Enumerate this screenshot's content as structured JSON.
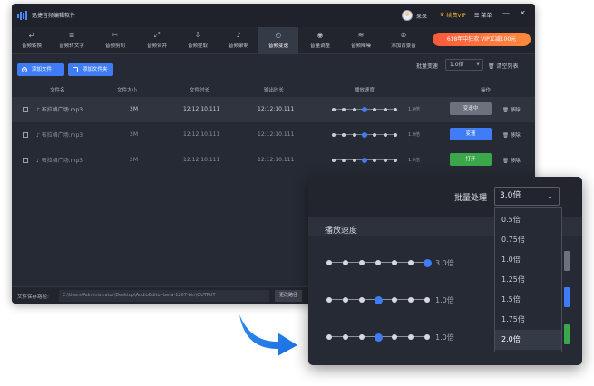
{
  "app": {
    "title": "迅捷音频编辑软件",
    "user": "呆呆",
    "vip": "续费VIP",
    "menu": "菜单",
    "win_min": "—",
    "win_close": "✕"
  },
  "toolbar": [
    {
      "label": "音频转换",
      "icon": "convert-icon",
      "glyph": "⇄"
    },
    {
      "label": "音频转文字",
      "icon": "text-icon",
      "glyph": "≣"
    },
    {
      "label": "音频剪切",
      "icon": "scissors-icon",
      "glyph": "✂"
    },
    {
      "label": "音频合并",
      "icon": "merge-icon",
      "glyph": "⤢"
    },
    {
      "label": "音频提取",
      "icon": "extract-icon",
      "glyph": "⇩"
    },
    {
      "label": "音频录制",
      "icon": "mic-icon",
      "glyph": "♪"
    },
    {
      "label": "音频变速",
      "icon": "speed-icon",
      "glyph": "◴",
      "active": true
    },
    {
      "label": "音量调整",
      "icon": "volume-icon",
      "glyph": "◉"
    },
    {
      "label": "音频降噪",
      "icon": "denoise-icon",
      "glyph": "≋"
    },
    {
      "label": "添加背景音",
      "icon": "music-icon",
      "glyph": "⊘"
    }
  ],
  "promo": "618年中狂欢 VIP立减100元",
  "actions": {
    "add_file": "添加文件",
    "add_folder": "添加文件夹",
    "batch_label": "批量变速",
    "batch_value": "1.0倍",
    "clear_list": "清空列表"
  },
  "columns": [
    "文件名",
    "文件大小",
    "文件时长",
    "输出时长",
    "播放速度",
    "操作"
  ],
  "rows": [
    {
      "name": "布拉格广场.mp3",
      "size": "2M",
      "duration": "12:12:10.111",
      "output": "12:12:10.111",
      "speed": "1.0倍",
      "action": "变速中",
      "remove": "移除",
      "active_dot": 3
    },
    {
      "name": "布拉格广场.mp3",
      "size": "2M",
      "duration": "12:12:10.111",
      "output": "12:12:10.111",
      "speed": "1.0倍",
      "action": "变速",
      "remove": "移除",
      "active_dot": 3
    },
    {
      "name": "布拉格广场.mp3",
      "size": "2M",
      "duration": "12:12:10.111",
      "output": "12:12:10.111",
      "speed": "1.0倍",
      "action": "打开",
      "remove": "移除",
      "active_dot": 3
    }
  ],
  "footer": {
    "label": "文件保存路径:",
    "path": "C:\\Users\\Administrator\\Desktop\\AudioEditor-beta-1207-bin\\OUTPUT",
    "change": "更改路径"
  },
  "zoom": {
    "batch_label": "批量处理",
    "batch_value": "3.0倍",
    "speed_header": "播放速度",
    "sliders": [
      {
        "value": "3.0倍",
        "active_dot": 6
      },
      {
        "value": "1.0倍",
        "active_dot": 3
      },
      {
        "value": "1.0倍",
        "active_dot": 3
      }
    ],
    "options": [
      "0.5倍",
      "0.75倍",
      "1.0倍",
      "1.25倍",
      "1.5倍",
      "1.75倍",
      "2.0倍"
    ],
    "selected_option": "2.0倍"
  },
  "colors": {
    "accent": "#3f7cf5",
    "green": "#3aa84a",
    "gray": "#6c717d",
    "promo": "#ff6a3c"
  }
}
